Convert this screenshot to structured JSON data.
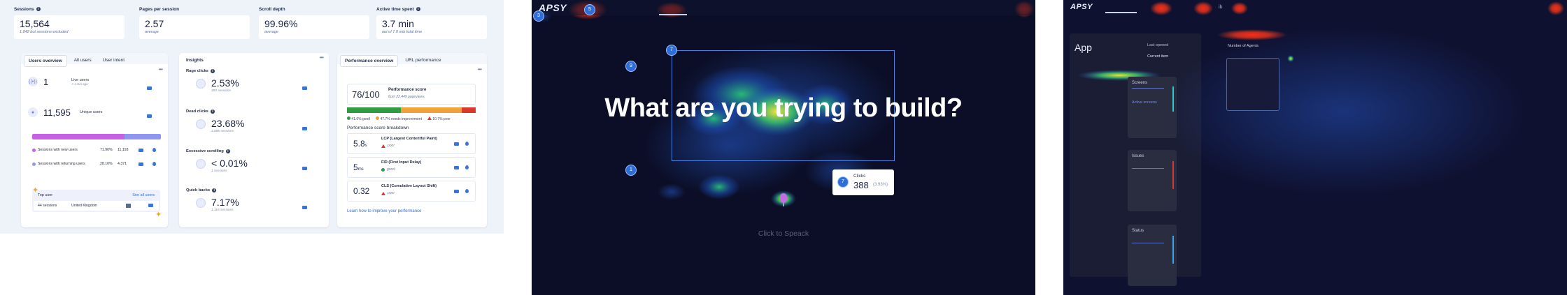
{
  "kpis": [
    {
      "label": "Sessions",
      "value": "15,564",
      "sub": "1,842 bot sessions excluded"
    },
    {
      "label": "Pages per session",
      "value": "2.57",
      "sub": "average"
    },
    {
      "label": "Scroll depth",
      "value": "99.96%",
      "sub": "average"
    },
    {
      "label": "Active time spent",
      "value": "3.7 min",
      "sub": "out of 7.0 min total time"
    }
  ],
  "users_card": {
    "tabs": [
      "Users overview",
      "All users",
      "User intent"
    ],
    "live_users": {
      "value": "1",
      "label": "Live users",
      "sub": "< 1 min ago"
    },
    "unique_users": {
      "value": "11,595",
      "label": "Unique users"
    },
    "new_pct": 71.9,
    "returning_pct": 28.1,
    "legend": [
      {
        "label": "Sessions with new users",
        "pct": "71.90%",
        "count": "11,193"
      },
      {
        "label": "Sessions with returning users",
        "pct": "28.10%",
        "count": "4,371"
      }
    ],
    "top_user": {
      "label": "Top user",
      "link": "See all users",
      "sessions": "44 sessions",
      "country": "United Kingdom"
    }
  },
  "insights": {
    "title": "Insights",
    "rows": [
      {
        "label": "Rage clicks",
        "value": "2.53%",
        "sub": "393 sessions"
      },
      {
        "label": "Dead clicks",
        "value": "23.68%",
        "sub": "3,686 sessions"
      },
      {
        "label": "Excessive scrolling",
        "value": "< 0.01%",
        "sub": "1 sessions"
      },
      {
        "label": "Quick backs",
        "value": "7.17%",
        "sub": "1,116 sessions"
      }
    ]
  },
  "performance": {
    "tabs": [
      "Performance overview",
      "URL performance"
    ],
    "score": "76/100",
    "score_label": "Performance score",
    "score_sub": "from 22,449 pageviews",
    "dist": [
      {
        "label": "41.6% good",
        "pct": 41.6,
        "color": "#2f9c44"
      },
      {
        "label": "47.7% needs improvement",
        "pct": 47.7,
        "color": "#f0a33a"
      },
      {
        "label": "10.7% poor",
        "pct": 10.7,
        "color": "#d8392b"
      }
    ],
    "breakdown_title": "Performance score breakdown",
    "breakdown": [
      {
        "value": "5.8",
        "unit": "s",
        "name": "LCP (Largest Contentful Paint)",
        "rating": "poor"
      },
      {
        "value": "5",
        "unit": "ms",
        "name": "FID (First Input Delay)",
        "rating": "good"
      },
      {
        "value": "0.32",
        "unit": "",
        "name": "CLS (Cumulative Layout Shift)",
        "rating": "poor"
      }
    ],
    "learn_link": "Learn how to improve your performance"
  },
  "heatmap_hero": {
    "logo": "APSY",
    "headline": "What are you trying to build?",
    "markers": [
      "3",
      "5",
      "9",
      "7",
      "1"
    ],
    "tooltip": {
      "label": "Clicks",
      "value": "388",
      "pct": "(3.93%)",
      "marker": "7"
    },
    "speak": "Click to Speack"
  },
  "heatmap_app": {
    "logo": "APSY",
    "nav_fragment": "ib",
    "title": "App",
    "panels": [
      "Screens",
      "Issues",
      "Status"
    ],
    "panel_link": "Active screens",
    "field_label": "Last opened",
    "field_value": "Current item",
    "thumb_label": "Number of Agents"
  },
  "colors": {
    "accent": "#3b74d8",
    "purple": "#c661e6",
    "lavender": "#8f96f2",
    "dark_bg": "#0b0e26"
  }
}
